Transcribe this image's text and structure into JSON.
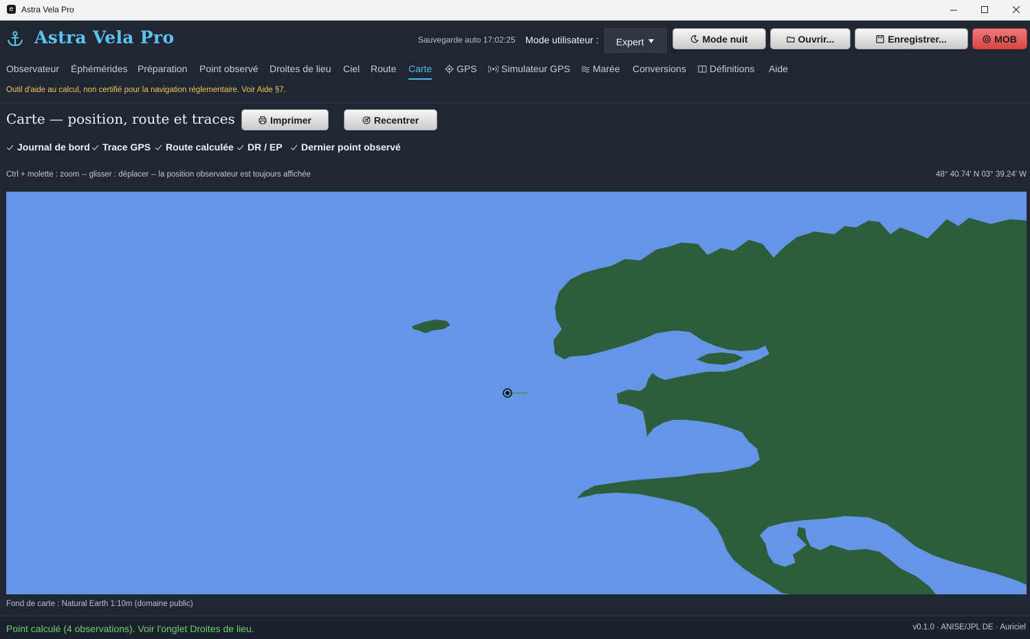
{
  "window": {
    "title": "Astra Vela Pro",
    "app_icon_glyph": "e",
    "controls": [
      "minimize-icon",
      "maximize-icon",
      "close-icon"
    ]
  },
  "header": {
    "app_title": "Astra Vela Pro",
    "logo_icon": "anchor-icon",
    "autosave": "Sauvegarde auto 17:02:25",
    "mode_label": "Mode utilisateur :",
    "mode_value": "Expert",
    "buttons": {
      "night": "Mode nuit",
      "open": "Ouvrir...",
      "save": "Enregistrer...",
      "mob": "MOB"
    },
    "accent_color": "#5cc3f0",
    "mob_color": "#d94545"
  },
  "tabs": [
    {
      "label": "Observateur"
    },
    {
      "label": "Éphémérides"
    },
    {
      "label": "Préparation"
    },
    {
      "label": "Point observé"
    },
    {
      "label": "Droites de lieu"
    },
    {
      "label": "Ciel"
    },
    {
      "label": "Route"
    },
    {
      "label": "Carte",
      "active": true
    },
    {
      "label": "GPS",
      "icon": "gps-icon"
    },
    {
      "label": "Simulateur GPS",
      "icon": "broadcast-icon"
    },
    {
      "label": "Marée",
      "icon": "waves-icon"
    },
    {
      "label": "Conversions"
    },
    {
      "label": "Définitions",
      "icon": "book-icon"
    },
    {
      "label": "Aide"
    }
  ],
  "warning": "Outil d'aide au calcul, non certifié pour la navigation réglementaire. Voir Aide §7.",
  "page": {
    "title": "Carte — position, route et traces",
    "print_label": "Imprimer",
    "recenter_label": "Recentrer"
  },
  "layers": [
    {
      "label": "Journal de bord",
      "checked": true
    },
    {
      "label": "Trace GPS",
      "checked": true
    },
    {
      "label": "Route calculée",
      "checked": true
    },
    {
      "label": "DR / EP",
      "checked": true
    },
    {
      "label": "Dernier point observé",
      "checked": true
    }
  ],
  "map": {
    "hint": "Ctrl + molette : zoom -- glisser : déplacer -- la position observateur est toujours affichée",
    "coords": "48° 40.74' N   03° 39.24' W",
    "sea_color": "#6495e6",
    "land_color": "#2d5e3c",
    "attribution": "Fond de carte : Natural Earth 1:10m (domaine public)"
  },
  "status": {
    "message": "Point calculé (4 observations). Voir l'onglet Droites de lieu.",
    "version": "v0.1.0 · ANISE/JPL DE · Auriciel"
  }
}
